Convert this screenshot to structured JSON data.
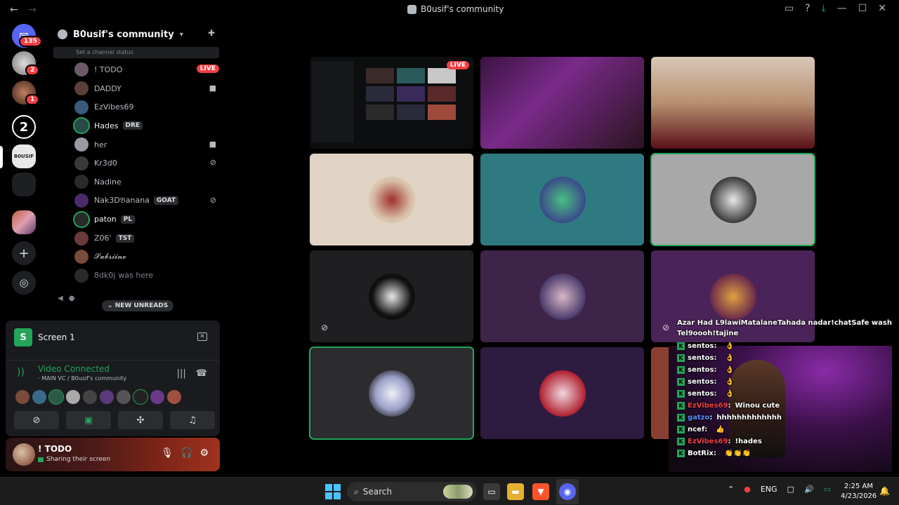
{
  "window": {
    "title": "B0usif's community",
    "nav_back": "←",
    "nav_forward": "→",
    "controls": {
      "inbox": "▭",
      "help": "?",
      "download": "⤓",
      "minimize": "—",
      "maximize": "☐",
      "close": "✕"
    }
  },
  "guild_rail": {
    "dm_badge": "135",
    "items": [
      {
        "badge": "2"
      },
      {
        "badge": "1"
      },
      {
        "label": "2"
      },
      {
        "label": "B0USIF"
      },
      {
        "label": ""
      },
      {
        "label": ""
      }
    ],
    "add_server": "+",
    "discover": "◎"
  },
  "server": {
    "name": "B0usif's community",
    "set_status_placeholder": "Set a channel status",
    "voice_users": [
      {
        "name": "! TODO",
        "live": "LIVE",
        "avatar_color": "#6a5a6a"
      },
      {
        "name": "DADDY",
        "icon": "camera",
        "avatar_color": "#5a4038"
      },
      {
        "name": "EzVibes69",
        "avatar_color": "#3a5a7a"
      },
      {
        "name": "Hades",
        "tag": "DRE",
        "avatar_color": "#2a4a4a",
        "highlight": true
      },
      {
        "name": "her",
        "icon": "camera",
        "avatar_color": "#9a9aa4"
      },
      {
        "name": "Kr3d0",
        "icon": "muted",
        "avatar_color": "#3a3a3a"
      },
      {
        "name": "Nadine",
        "avatar_color": "#2a2a2a"
      },
      {
        "name": "Nak3D𝔅anana",
        "tag": "GOAT",
        "icon": "muted",
        "avatar_color": "#4a2a6a"
      },
      {
        "name": "paton",
        "tag": "PL",
        "avatar_color": "#2a2a2a",
        "highlight": true
      },
      {
        "name": "Z06'",
        "tag": "TST",
        "avatar_color": "#6a3a3a"
      },
      {
        "name": "𝓢𝓪𝓫𝓻𝓲𝓲𝓷𝓮",
        "avatar_color": "#7a4a3a"
      },
      {
        "name": "8dk0j",
        "suffix": "was here",
        "avatar_color": "#2a2a2a",
        "dimmed": true
      }
    ],
    "new_unreads": "NEW UNREADS"
  },
  "screen_share": {
    "title": "Screen 1",
    "video_connected": "Video Connected",
    "channel_path": "· MAIN VC / B0usif's community",
    "buttons": [
      "camera-off",
      "share-screen",
      "activities",
      "soundboard"
    ]
  },
  "user_panel": {
    "name": "! TODO",
    "status": "Sharing their screen"
  },
  "tiles": [
    {
      "kind": "screen",
      "live": "LIVE"
    },
    {
      "kind": "video",
      "bg": "linear-gradient(135deg,#3a1440 0%,#7a2a8a 40%,#2a1420 100%)"
    },
    {
      "kind": "video",
      "bg": "linear-gradient(180deg,#d8c8b8 0%,#b89070 50%,#5a1018 100%)"
    },
    {
      "kind": "avatar",
      "bg": "#e0d3c4",
      "av": "radial-gradient(circle,#a03030 0%,#d8c0a8 60%,#e0d3c4 100%)"
    },
    {
      "kind": "avatar",
      "bg": "#2f7a80",
      "av": "radial-gradient(circle,#4ac080 0%,#3a4a8a 70%)"
    },
    {
      "kind": "avatar",
      "bg": "#a8a8a8",
      "av": "radial-gradient(circle,#e8e8e8 0%,#3a3a3a 70%)",
      "speaking": true
    },
    {
      "kind": "avatar",
      "bg": "#1f1f22",
      "av": "radial-gradient(circle,#e8e8e8 0%,#101010 60%)",
      "muted": true
    },
    {
      "kind": "avatar",
      "bg": "#3e2448",
      "av": "radial-gradient(circle,#d8b8c8 0%,#4a3a6a 70%)"
    },
    {
      "kind": "avatar",
      "bg": "#4a2458",
      "av": "radial-gradient(circle,#e0a040 0%,#6a2a4a 70%)",
      "muted": true
    },
    {
      "kind": "avatar",
      "bg": "#2c2c2e",
      "av": "radial-gradient(circle,#f0f0f8 0%,#9aa0c8 50%,#2c2c2e 80%)",
      "speaking": true
    },
    {
      "kind": "avatar",
      "bg": "#2e1c40",
      "av": "radial-gradient(circle,#f0d8e0 0%,#b02030 70%)"
    },
    {
      "kind": "avatar",
      "bg": "#8a4030",
      "av": "none"
    }
  ],
  "chat": {
    "header": "Azar Had L9lawiMatalaneTahada nadar!chatSafe wash Tel9oooh!tajine",
    "messages": [
      {
        "user": "sentos",
        "color": "#ffffff",
        "text": "",
        "emoji": "👌"
      },
      {
        "user": "sentos",
        "color": "#ffffff",
        "text": "",
        "emoji": "👌"
      },
      {
        "user": "sentos",
        "color": "#ffffff",
        "text": "",
        "emoji": "👌"
      },
      {
        "user": "sentos",
        "color": "#ffffff",
        "text": "",
        "emoji": "👌"
      },
      {
        "user": "sentos",
        "color": "#ffffff",
        "text": "",
        "emoji": "👌"
      },
      {
        "user": "EzVibes69",
        "color": "#f23f43",
        "text": "Winou cute",
        "emoji": ""
      },
      {
        "user": "gatzo",
        "color": "#5b8cff",
        "text": "hhhhhhhhhhhhh",
        "emoji": ""
      },
      {
        "user": "ncef",
        "color": "#ffffff",
        "text": "",
        "emoji": "👍"
      },
      {
        "user": "EzVibes69",
        "color": "#f23f43",
        "text": "!hades",
        "emoji": ""
      },
      {
        "user": "BotRix",
        "color": "#ffffff",
        "text": "",
        "emoji": "👏👏👏"
      }
    ]
  },
  "taskbar": {
    "search": "Search",
    "lang": "ENG",
    "time": "2:25 AM",
    "date": "4/23/2026"
  },
  "colors": {
    "accent": "#5865f2",
    "live": "#f23f43",
    "green": "#23a55a"
  }
}
